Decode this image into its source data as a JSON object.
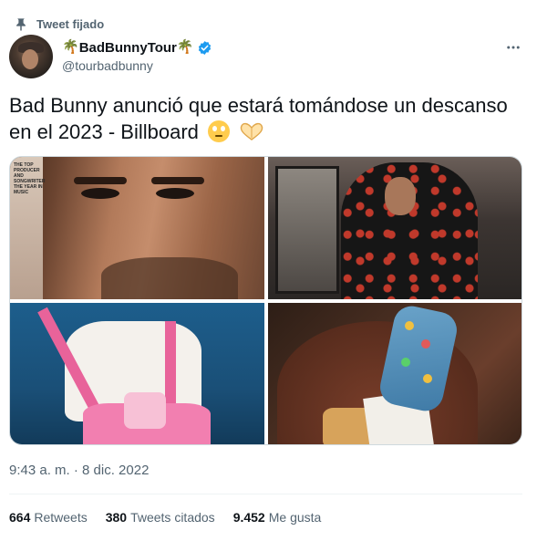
{
  "pinned": {
    "label": "Tweet fijado"
  },
  "author": {
    "display_name": "BadBunnyTour",
    "name_emoji": "🌴",
    "handle": "@tourbadbunny",
    "verified": true,
    "verified_color": "#1d9bf0"
  },
  "tweet": {
    "text": "Bad Bunny anunció que estará tomándose un descanso en el 2023 - Billboard",
    "emojis": [
      "face-with-rolling-eyes",
      "heart-hands"
    ]
  },
  "media": {
    "count": 4,
    "cover_text": "THE TOP PRODUCER AND SONGWRITER THE YEAR IN MUSIC"
  },
  "meta": {
    "timestamp": "9:43 a. m. · 8 dic. 2022"
  },
  "stats": {
    "retweets_count": "664",
    "retweets_label": "Retweets",
    "quotes_count": "380",
    "quotes_label": "Tweets citados",
    "likes_count": "9.452",
    "likes_label": "Me gusta"
  },
  "colors": {
    "text_primary": "#0f1419",
    "text_secondary": "#536471",
    "accent": "#1d9bf0"
  },
  "icons": [
    "pin-icon",
    "verified-badge-icon",
    "more-options-icon"
  ]
}
